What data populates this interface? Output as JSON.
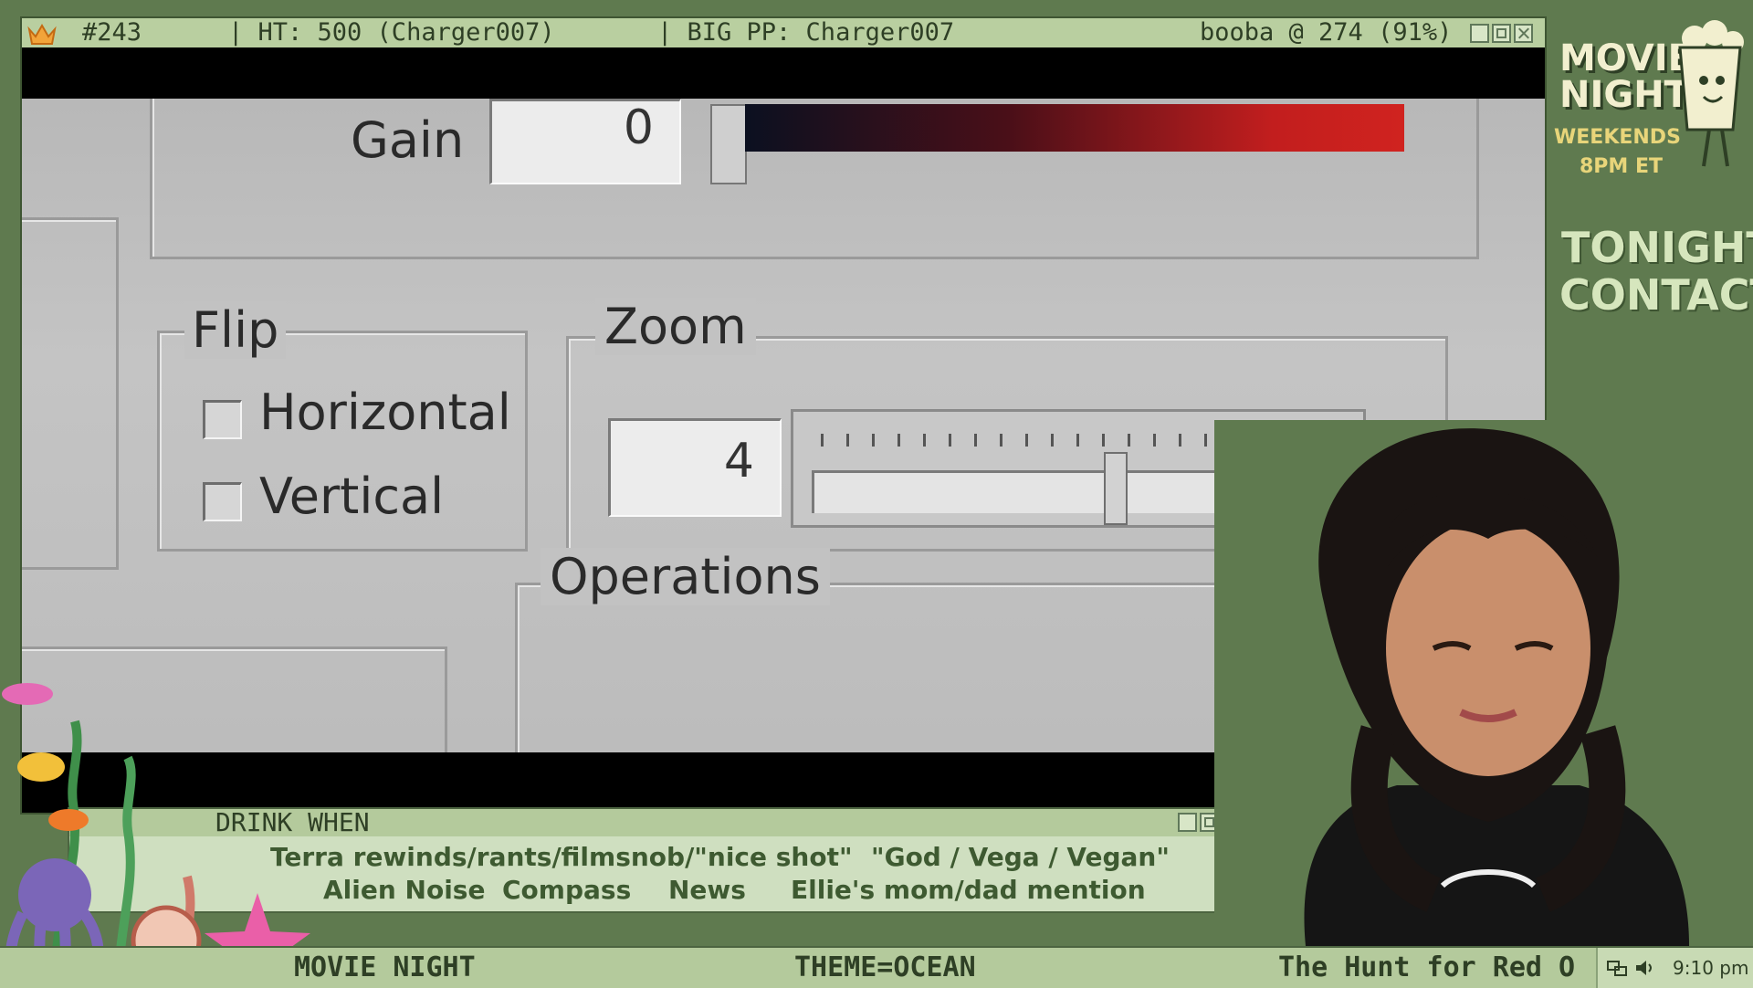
{
  "titlebar": {
    "episode": "#243",
    "ht": "| HT: 500 (Charger007)",
    "big_pp": "| BIG PP: Charger007",
    "emote": "booba @ 274 (91%)"
  },
  "video": {
    "gain_label": "Gain",
    "gain_value": "0",
    "flip_label": "Flip",
    "horizontal_label": "Horizontal",
    "vertical_label": "Vertical",
    "zoom_label": "Zoom",
    "zoom_value": "4",
    "operations_label": "Operations"
  },
  "drink": {
    "title": "DRINK WHEN",
    "line1_a": "Terra rewinds/rants/filmsnob/\"nice shot\"",
    "line1_b": "\"God / Vega / Vegan\"",
    "line2_a": "Alien Noise",
    "line2_b": "Compass",
    "line2_c": "News",
    "line2_d": "Ellie's mom/dad mention"
  },
  "bottom_bar": {
    "left": "MOVIE NIGHT",
    "center": "THEME=OCEAN",
    "ticker": "The Hunt for Red O",
    "clock": "9:10 pm"
  },
  "promo": {
    "movie": "MOVIE",
    "night": "NIGHT",
    "weekends": "WEEKENDS",
    "time": "8PM ET",
    "tonight": "TONIGHT:",
    "film": "CONTACT"
  },
  "colors": {
    "frame_green": "#5f7a4f",
    "bar_green": "#b4ca9c",
    "text_dark": "#2e3f25",
    "gain_gradient_end": "#d0231f"
  },
  "icons": [
    "crown-icon",
    "minimize-icon",
    "maximize-icon",
    "close-icon",
    "network-icon",
    "volume-icon"
  ]
}
